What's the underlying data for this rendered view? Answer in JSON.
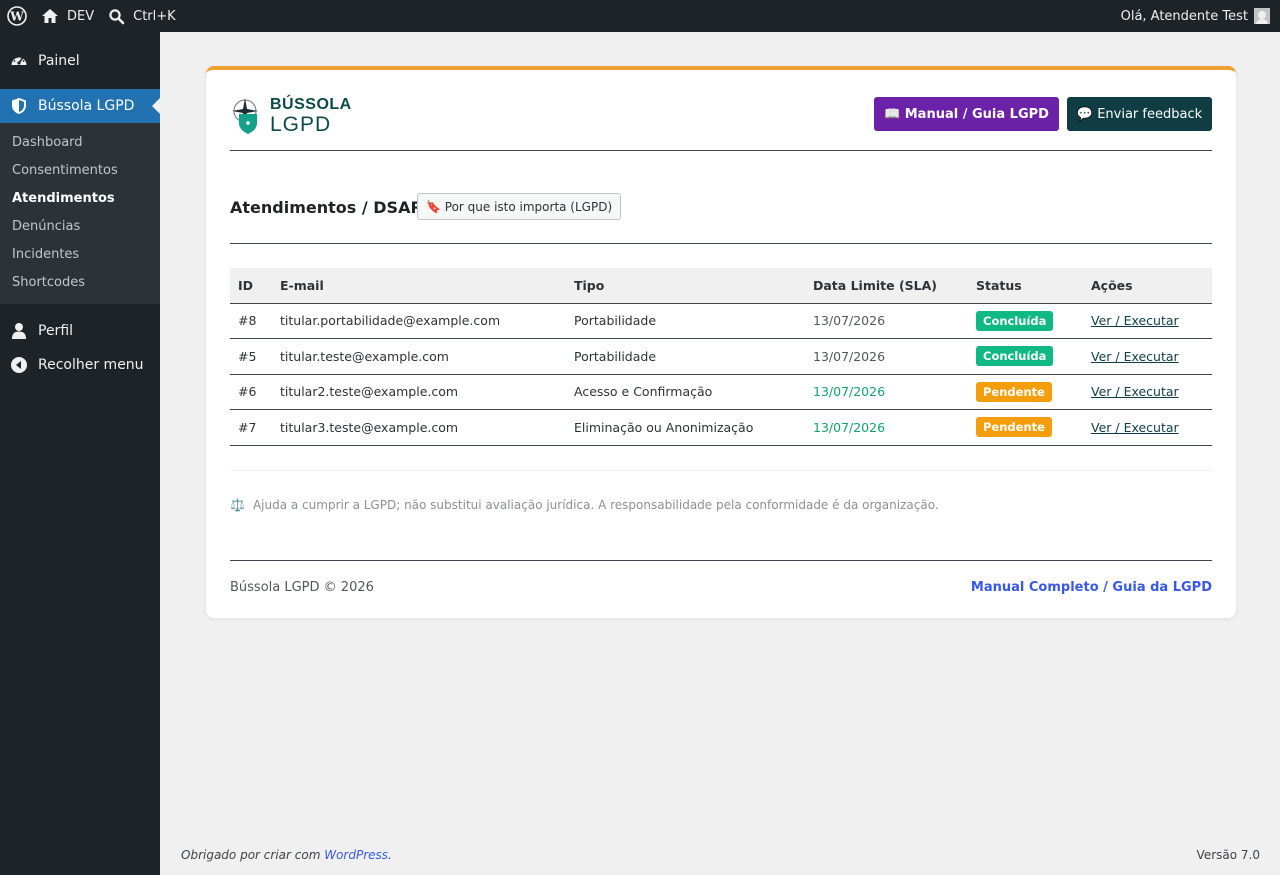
{
  "adminbar": {
    "site_name": "DEV",
    "shortcut": "Ctrl+K",
    "greeting": "Olá, Atendente Test"
  },
  "sidebar": {
    "items": [
      {
        "label": "Painel",
        "icon": "dashboard-icon"
      },
      {
        "label": "Bússola LGPD",
        "icon": "shield-icon"
      },
      {
        "label": "Perfil",
        "icon": "user-icon"
      },
      {
        "label": "Recolher menu",
        "icon": "collapse-icon"
      }
    ],
    "submenu": [
      "Dashboard",
      "Consentimentos",
      "Atendimentos",
      "Denúncias",
      "Incidentes",
      "Shortcodes"
    ]
  },
  "card": {
    "logo_top": "BÚSSOLA",
    "logo_bottom": "LGPD",
    "manual_button": "📖 Manual / Guia LGPD",
    "feedback_button": "💬 Enviar feedback",
    "page_title": "Atendimentos / DSAR",
    "why_button": "🔖 Por que isto importa (LGPD)",
    "table": {
      "headers": [
        "ID",
        "E-mail",
        "Tipo",
        "Data Limite (SLA)",
        "Status",
        "Ações"
      ],
      "rows": [
        {
          "id": "#8",
          "email": "titular.portabilidade@example.com",
          "tipo": "Portabilidade",
          "date": "13/07/2026",
          "status": "Concluída",
          "action": "Ver / Executar"
        },
        {
          "id": "#5",
          "email": "titular.teste@example.com",
          "tipo": "Portabilidade",
          "date": "13/07/2026",
          "status": "Concluída",
          "action": "Ver / Executar"
        },
        {
          "id": "#6",
          "email": "titular2.teste@example.com",
          "tipo": "Acesso e Confirmação",
          "date": "13/07/2026",
          "status": "Pendente",
          "action": "Ver / Executar"
        },
        {
          "id": "#7",
          "email": "titular3.teste@example.com",
          "tipo": "Eliminação ou Anonimização",
          "date": "13/07/2026",
          "status": "Pendente",
          "action": "Ver / Executar"
        }
      ]
    },
    "disclaimer_icon": "⚖️",
    "disclaimer": "Ajuda a cumprir a LGPD; não substitui avaliação jurídica. A responsabilidade pela conformidade é da organização.",
    "copyright": "Bússola LGPD © 2026",
    "footer_link": "Manual Completo / Guia da LGPD"
  },
  "footer": {
    "thanks_prefix": "Obrigado por criar com",
    "thanks_link": "WordPress",
    "thanks_suffix": ".",
    "version": "Versão 7.0"
  },
  "colors": {
    "accent_top": "#f0a030",
    "manual_btn": "#6b21a8",
    "feedback_btn": "#0f3d43",
    "done": "#10b981",
    "pending": "#f59e0b",
    "active_menu": "#2271b1"
  }
}
